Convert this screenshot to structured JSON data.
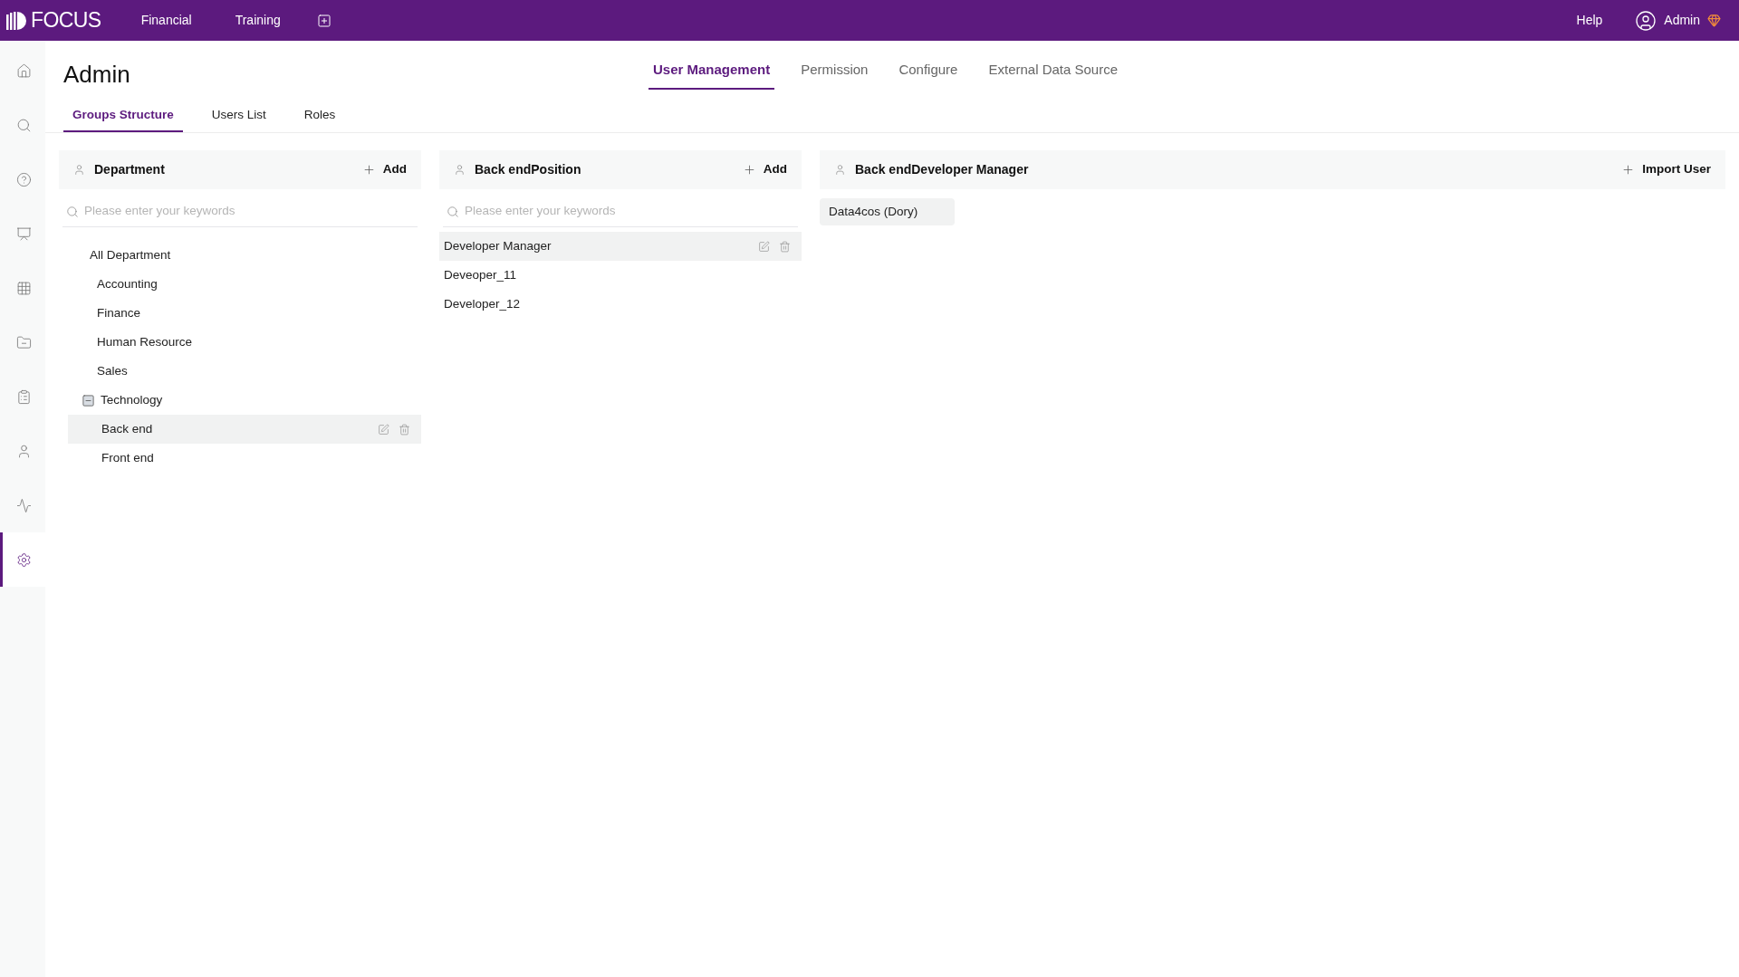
{
  "top_bar": {
    "logo": "FOCUS",
    "menu": [
      "Financial",
      "Training"
    ],
    "help": "Help",
    "user": "Admin"
  },
  "sidebar": {
    "items": [
      {
        "kind": "home",
        "selected": false
      },
      {
        "kind": "search",
        "selected": false
      },
      {
        "kind": "help",
        "selected": false
      },
      {
        "kind": "presentation",
        "selected": false
      },
      {
        "kind": "grid",
        "selected": false
      },
      {
        "kind": "folder",
        "selected": false
      },
      {
        "kind": "clipboard",
        "selected": false
      },
      {
        "kind": "user",
        "selected": false
      },
      {
        "kind": "activity",
        "selected": false
      },
      {
        "kind": "settings",
        "selected": true
      }
    ]
  },
  "page_title": "Admin",
  "main_tabs": [
    {
      "label": "User Management",
      "selected": true
    },
    {
      "label": "Permission",
      "selected": false
    },
    {
      "label": "Configure",
      "selected": false
    },
    {
      "label": "External Data Source",
      "selected": false
    }
  ],
  "sub_tabs": [
    {
      "label": "Groups Structure",
      "selected": true
    },
    {
      "label": "Users List",
      "selected": false
    },
    {
      "label": "Roles",
      "selected": false
    }
  ],
  "department_panel": {
    "title": "Department",
    "action": "Add",
    "search": {
      "placeholder": "Please enter your keywords"
    },
    "tree": [
      {
        "label": "All Department",
        "selected": false,
        "children": [
          {
            "label": "Accounting",
            "selected": false
          },
          {
            "label": "Finance",
            "selected": false
          },
          {
            "label": "Human Resource",
            "selected": false
          },
          {
            "label": "Sales",
            "selected": false
          },
          {
            "label": "Technology",
            "selected": false,
            "expanded": true,
            "children": [
              {
                "label": "Back end",
                "selected": true
              },
              {
                "label": "Front end",
                "selected": false
              }
            ]
          }
        ]
      }
    ]
  },
  "position_panel": {
    "title": "Back endPosition",
    "action": "Add",
    "search": {
      "placeholder": "Please enter your keywords"
    },
    "items": [
      {
        "label": "Developer Manager",
        "selected": true
      },
      {
        "label": "Deveoper_11",
        "selected": false
      },
      {
        "label": "Developer_12",
        "selected": false
      }
    ]
  },
  "users_panel": {
    "title": "Back endDeveloper Manager",
    "action": "Import User",
    "users": [
      "Data4cos (Dory)"
    ]
  }
}
